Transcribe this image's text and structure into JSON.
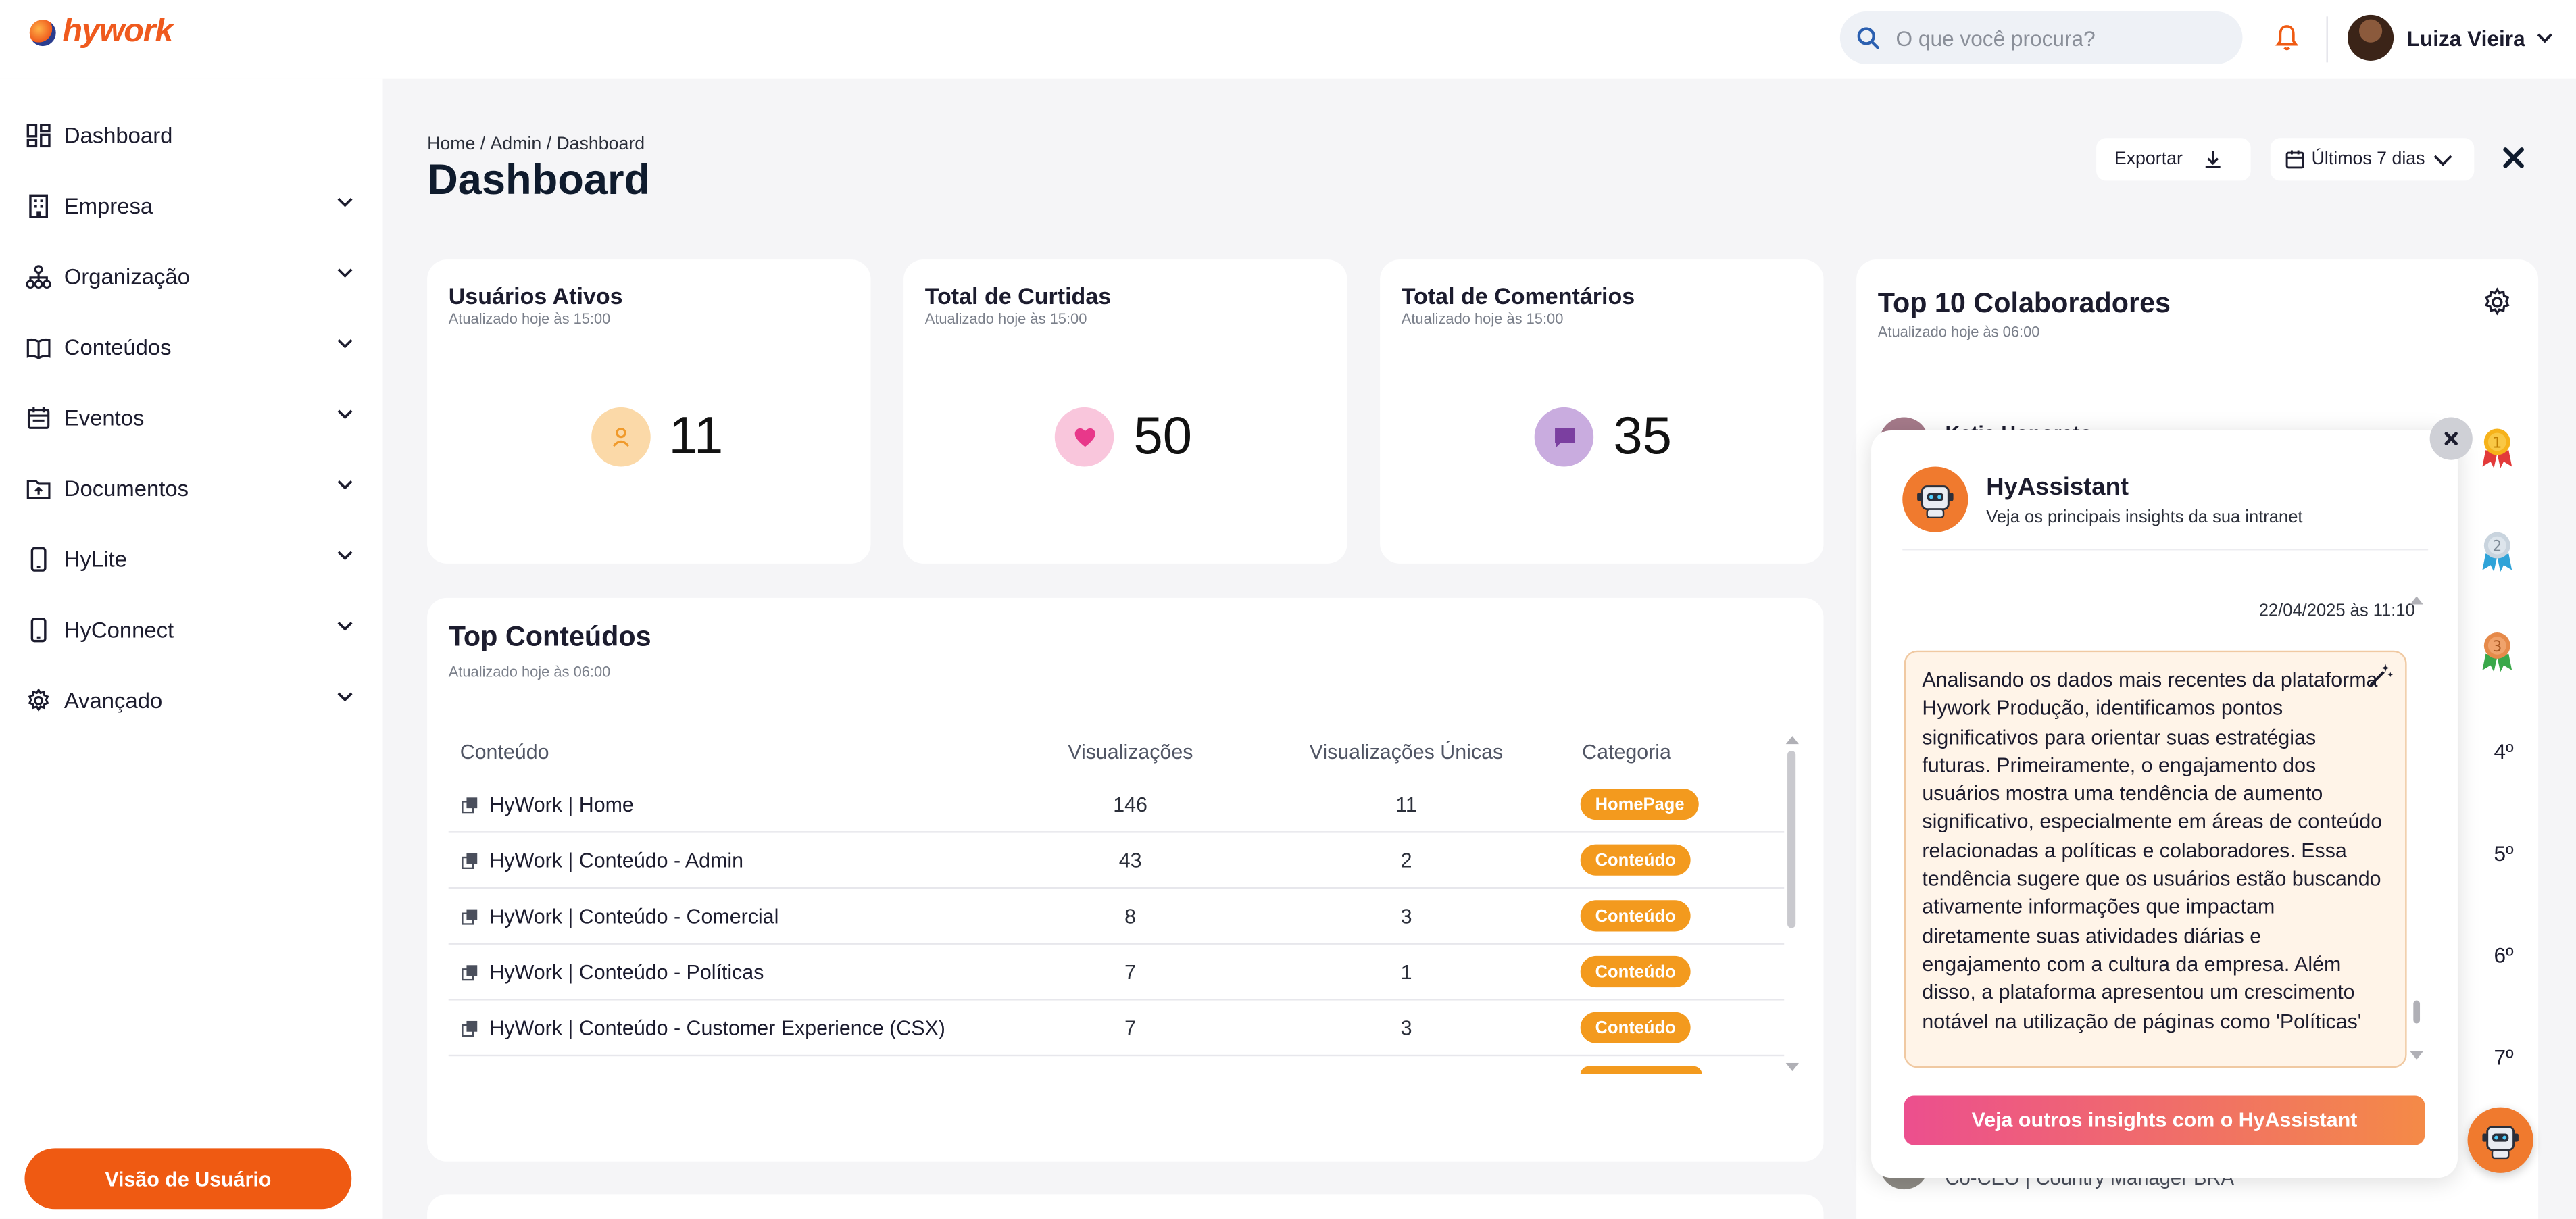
{
  "brand": {
    "logo_text": "hywork"
  },
  "search": {
    "placeholder": "O que você procura?"
  },
  "user": {
    "name": "Luiza Vieira"
  },
  "sidebar": {
    "items": [
      {
        "label": "Dashboard",
        "icon": "grid-icon"
      },
      {
        "label": "Empresa",
        "icon": "building-icon"
      },
      {
        "label": "Organização",
        "icon": "org-chart-icon"
      },
      {
        "label": "Conteúdos",
        "icon": "book-open-icon"
      },
      {
        "label": "Eventos",
        "icon": "calendar-icon"
      },
      {
        "label": "Documentos",
        "icon": "folder-upload-icon"
      },
      {
        "label": "HyLite",
        "icon": "phone-icon"
      },
      {
        "label": "HyConnect",
        "icon": "phone-icon"
      },
      {
        "label": "Avançado",
        "icon": "gear-icon"
      }
    ],
    "user_view_button": "Visão de Usuário"
  },
  "breadcrumb": {
    "home": "Home",
    "admin": "Admin",
    "current": "Dashboard",
    "sep": "/"
  },
  "page_title": "Dashboard",
  "toolbar": {
    "export_label": "Exportar",
    "range_label": "Últimos 7 dias"
  },
  "stats": [
    {
      "title": "Usuários Ativos",
      "updated": "Atualizado hoje às 15:00",
      "value": "11",
      "icon": "user-icon",
      "color": "#f9c98a"
    },
    {
      "title": "Total de Curtidas",
      "updated": "Atualizado hoje às 15:00",
      "value": "50",
      "icon": "heart-icon",
      "color": "#f7b6d4"
    },
    {
      "title": "Total de Comentários",
      "updated": "Atualizado hoje às 15:00",
      "value": "35",
      "icon": "comment-icon",
      "color": "#c8a9dd"
    }
  ],
  "top_contents": {
    "title": "Top Conteúdos",
    "updated": "Atualizado hoje às 06:00",
    "columns": [
      "Conteúdo",
      "Visualizações",
      "Visualizações Únicas",
      "Categoria"
    ],
    "rows": [
      {
        "name": "HyWork | Home",
        "views": "146",
        "unique": "11",
        "category": "HomePage"
      },
      {
        "name": "HyWork | Conteúdo - Admin",
        "views": "43",
        "unique": "2",
        "category": "Conteúdo"
      },
      {
        "name": "HyWork | Conteúdo - Comercial",
        "views": "8",
        "unique": "3",
        "category": "Conteúdo"
      },
      {
        "name": "HyWork | Conteúdo - Políticas",
        "views": "7",
        "unique": "1",
        "category": "Conteúdo"
      },
      {
        "name": "HyWork | Conteúdo - Customer Experience (CSX)",
        "views": "7",
        "unique": "3",
        "category": "Conteúdo"
      }
    ]
  },
  "top_collaborators": {
    "title": "Top 10 Colaboradores",
    "updated": "Atualizado hoje às 06:00",
    "first_name": "Katia Honorato",
    "last_role": "Co-CEO | Country Manager BRA",
    "ranks": [
      "4º",
      "5º",
      "6º",
      "7º"
    ]
  },
  "assistant": {
    "title": "HyAssistant",
    "subtitle": "Veja os principais insights da sua intranet",
    "date": "22/04/2025 às 11:10",
    "message": "Analisando os dados mais recentes da plataforma Hywork Produção, identificamos pontos significativos para orientar suas estratégias futuras. Primeiramente, o engajamento dos usuários mostra uma tendência de aumento significativo, especialmente em áreas de conteúdo relacionadas a políticas e colaboradores. Essa tendência sugere que os usuários estão buscando ativamente informações que impactam diretamente suas atividades diárias e engajamento com a cultura da empresa. Além disso, a plataforma apresentou um crescimento notável na utilização de páginas como 'Políticas'",
    "cta": "Veja outros insights com o HyAssistant"
  },
  "colors": {
    "accent": "#ef5a12",
    "badge": "#f39a1e",
    "assistant_gradient_start": "#ec4f8e",
    "assistant_gradient_end": "#f48a47"
  }
}
